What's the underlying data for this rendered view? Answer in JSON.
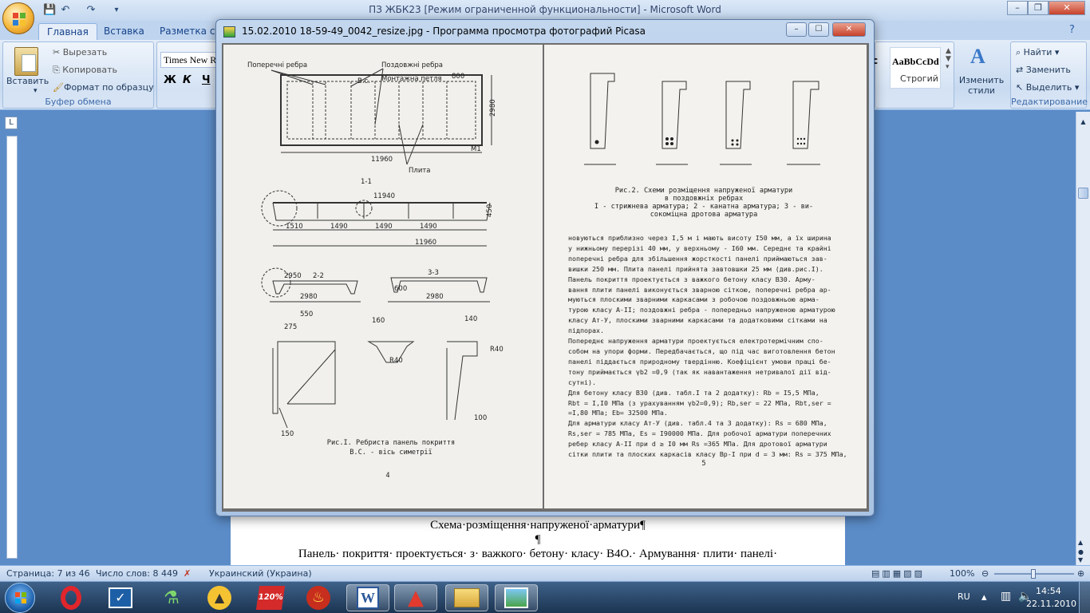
{
  "word": {
    "title": "ПЗ ЖБК23 [Режим ограниченной функциональности] - Microsoft Word",
    "tabs": [
      "Главная",
      "Вставка",
      "Разметка стр"
    ],
    "clipboard": {
      "paste": "Вставить",
      "cut": "Вырезать",
      "copy": "Копировать",
      "format_painter": "Формат по образцу",
      "group_label": "Буфер обмена"
    },
    "font": {
      "name": "Times New Ro",
      "bold": "Ж",
      "italic": "К",
      "underline": "Ч"
    },
    "styles": {
      "preview": "AaBbCcDd",
      "preview_partial": "c",
      "style_name": "Строгий",
      "change_styles": "Изменить стили"
    },
    "editing": {
      "find": "Найти",
      "replace": "Заменить",
      "select": "Выделить",
      "group_label": "Редактирование"
    },
    "document": {
      "lines": [
        "Схема·розміщення·напруженої·арматури¶",
        "¶",
        "Панель· покриття· проектується· з· важкого· бетону· класу· В4О.· Армування· плити· панелі·"
      ]
    },
    "status": {
      "page": "Страница: 7 из 46",
      "words": "Число слов: 8 449",
      "language": "Украинский (Украина)",
      "zoom": "100%"
    }
  },
  "picasa": {
    "title": "15.02.2010 18-59-49_0042_resize.jpg - Программа просмотра фотографий Picasa",
    "photo": {
      "left_page": {
        "labels": {
          "cross_ribs": "Поперечні ребра",
          "long_ribs": "Поздовжні ребра",
          "mount_loop": "Монтажна петля",
          "slab": "Плита",
          "vs": "В.с.",
          "m1": "М1",
          "dim_800": "800",
          "dim_2980": "2980",
          "dim_11960": "11960",
          "dim_11940": "11940",
          "section_1_1": "1-1",
          "section_2_2": "2-2",
          "section_3_3": "3-3",
          "dim_1510": "1510",
          "dim_1490": "1490",
          "dim_2950": "2950",
          "dim_450": "450",
          "dim_600": "600",
          "dim_550": "550",
          "dim_275": "275",
          "dim_160": "160",
          "dim_140": "140",
          "r40": "R40",
          "dim_150": "150",
          "dim_100": "100"
        },
        "caption1": "Рис.І. Ребриста панель покриття",
        "caption2": "В.С. - вісь симетрії",
        "page_number": "4"
      },
      "right_page": {
        "caption_lines": [
          "Рис.2. Схеми розміщення напруженої арматури",
          "в поздовжніх ребрах",
          "І - стрижнева арматура; 2 - канатна арматура; 3 - ви-",
          "сокоміцна дротова арматура"
        ],
        "text_lines": [
          "новуються приблизно через І,5 м і мають висоту І50 мм, а їх  ширина",
          "у нижньому перерізі 40 мм, у верхньому - І60 мм. Середнє та  крайні",
          "поперечні ребра для збільшення жорсткості панелі  приймаються  зав-",
          "вишки 250 мм. Плита панелі прийнята завтовшки 25 мм (див.рис.І).",
          "   Панель покриття проектується з важкого бетону  класу В30.  Арму-",
          "вання плити панелі виконується зварною сіткою,  поперечні ребра ар-",
          "муються плоскими зварними каркасами  з  робочою  поздовжньою  арма-",
          "турою класу А-ІІ; поздовжні ребра - попередньо  напруженою арматурою",
          "класу Ат-У, плоскими зварними каркасами та додатковими  сітками  на",
          "підпорах.",
          "   Попереднє напруження арматури проектується електротермічним спо-",
          "собом на упори форми. Передбачається, що під час виготовлення бетон",
          "панелі піддається природному твердінню.  Коефіцієнт умови праці бе-",
          "тону приймається   γb2 =0,9 (так як навантаження нетривалої дії  від-",
          "сутні).",
          "   Для бетону класу В30 (див. табл.І та 2 додатку):  Rb = І5,5 МПа,",
          "Rbt = І,І0 МПа (з урахуванням  γb2=0,9);  Rb,ser = 22 МПа,  Rbt,ser =",
          " =І,80 МПа;  Eb= 32500 МПа.",
          "   Для арматури класу Ат-У (див. табл.4 та 3 додатку): Rs = 680 МПа,",
          "Rs,ser = 785 МПа, Es = І90000 МПа. Для робочої арматури  поперечних",
          "ребер класу А-ІІ при d ≥ І0 мм   Rs =365 МПа.  Для дротової  арматури",
          "сітки плити та плоских каркасів класу Вр-І при d = 3 мм:  Rs = 375 МПа,"
        ],
        "page_number": "5"
      }
    }
  },
  "taskbar": {
    "lang": "RU",
    "time": "14:54",
    "date": "22.11.2010"
  }
}
